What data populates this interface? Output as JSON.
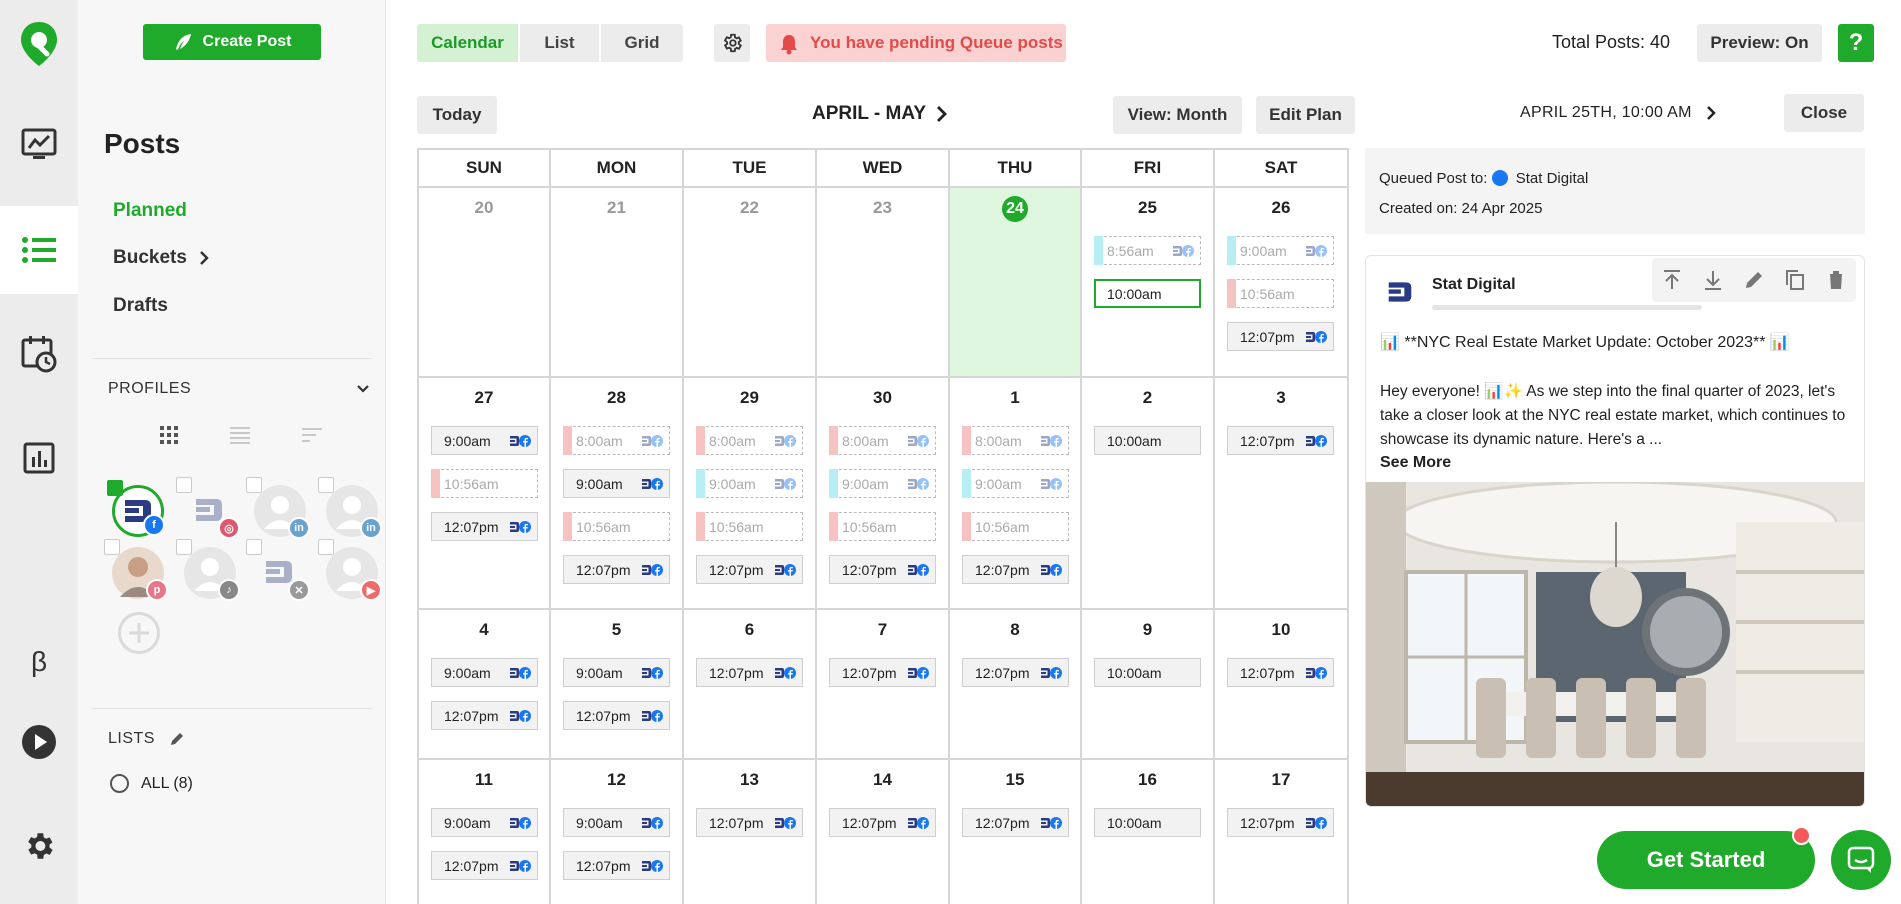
{
  "sidebar": {
    "create_post_label": "Create Post",
    "title": "Posts",
    "nav": [
      "Planned",
      "Buckets",
      "Drafts"
    ],
    "profiles_label": "PROFILES",
    "lists_label": "LISTS",
    "all_label": "ALL (8)",
    "rail_icons": [
      "logo-pin-icon",
      "analytics-icon",
      "posts-list-icon",
      "schedule-icon",
      "reports-icon",
      "beta-icon",
      "play-icon",
      "settings-icon"
    ],
    "beta_glyph": "β"
  },
  "toolbar": {
    "views": [
      "Calendar",
      "List",
      "Grid"
    ],
    "alert_text": "You have pending Queue posts",
    "total_posts": "Total Posts: 40",
    "preview_label": "Preview: On",
    "help_label": "?"
  },
  "calendar": {
    "today_label": "Today",
    "range_label": "APRIL - MAY",
    "view_label": "View: Month",
    "edit_plan_label": "Edit Plan",
    "days_of_week": [
      "SUN",
      "MON",
      "TUE",
      "WED",
      "THU",
      "FRI",
      "SAT"
    ],
    "weeks": [
      [
        {
          "day": "20",
          "state": "past",
          "posts": []
        },
        {
          "day": "21",
          "state": "past",
          "posts": []
        },
        {
          "day": "22",
          "state": "past",
          "posts": []
        },
        {
          "day": "23",
          "state": "past",
          "posts": []
        },
        {
          "day": "24",
          "state": "today",
          "posts": []
        },
        {
          "day": "25",
          "state": "",
          "posts": [
            {
              "time": "8:56am",
              "style": "dashed",
              "bar": "cyan",
              "icon": true
            },
            {
              "time": "10:00am",
              "style": "selected",
              "bar": "",
              "icon": false
            }
          ]
        },
        {
          "day": "26",
          "state": "",
          "posts": [
            {
              "time": "9:00am",
              "style": "dashed",
              "bar": "cyan",
              "icon": true
            },
            {
              "time": "10:56am",
              "style": "dashed",
              "bar": "pink",
              "icon": false
            },
            {
              "time": "12:07pm",
              "style": "solid",
              "bar": "",
              "icon": true
            }
          ]
        }
      ],
      [
        {
          "day": "27",
          "state": "",
          "posts": [
            {
              "time": "9:00am",
              "style": "solid",
              "bar": "",
              "icon": true
            },
            {
              "time": "10:56am",
              "style": "dashed",
              "bar": "pink",
              "icon": false
            },
            {
              "time": "12:07pm",
              "style": "solid",
              "bar": "",
              "icon": true
            }
          ]
        },
        {
          "day": "28",
          "state": "",
          "posts": [
            {
              "time": "8:00am",
              "style": "dashed",
              "bar": "pink",
              "icon": true
            },
            {
              "time": "9:00am",
              "style": "solid",
              "bar": "",
              "icon": true
            },
            {
              "time": "10:56am",
              "style": "dashed",
              "bar": "pink",
              "icon": false
            },
            {
              "time": "12:07pm",
              "style": "solid",
              "bar": "",
              "icon": true
            }
          ]
        },
        {
          "day": "29",
          "state": "",
          "posts": [
            {
              "time": "8:00am",
              "style": "dashed",
              "bar": "pink",
              "icon": true
            },
            {
              "time": "9:00am",
              "style": "dashed",
              "bar": "cyan",
              "icon": true
            },
            {
              "time": "10:56am",
              "style": "dashed",
              "bar": "pink",
              "icon": false
            },
            {
              "time": "12:07pm",
              "style": "solid",
              "bar": "",
              "icon": true
            }
          ]
        },
        {
          "day": "30",
          "state": "",
          "posts": [
            {
              "time": "8:00am",
              "style": "dashed",
              "bar": "pink",
              "icon": true
            },
            {
              "time": "9:00am",
              "style": "dashed",
              "bar": "cyan",
              "icon": true
            },
            {
              "time": "10:56am",
              "style": "dashed",
              "bar": "pink",
              "icon": false
            },
            {
              "time": "12:07pm",
              "style": "solid",
              "bar": "",
              "icon": true
            }
          ]
        },
        {
          "day": "1",
          "state": "",
          "posts": [
            {
              "time": "8:00am",
              "style": "dashed",
              "bar": "pink",
              "icon": true
            },
            {
              "time": "9:00am",
              "style": "dashed",
              "bar": "cyan",
              "icon": true
            },
            {
              "time": "10:56am",
              "style": "dashed",
              "bar": "pink",
              "icon": false
            },
            {
              "time": "12:07pm",
              "style": "solid",
              "bar": "",
              "icon": true
            }
          ]
        },
        {
          "day": "2",
          "state": "",
          "posts": [
            {
              "time": "10:00am",
              "style": "solid",
              "bar": "",
              "icon": false
            }
          ]
        },
        {
          "day": "3",
          "state": "",
          "posts": [
            {
              "time": "12:07pm",
              "style": "solid",
              "bar": "",
              "icon": true
            }
          ]
        }
      ],
      [
        {
          "day": "4",
          "state": "",
          "posts": [
            {
              "time": "9:00am",
              "style": "solid",
              "bar": "",
              "icon": true
            },
            {
              "time": "12:07pm",
              "style": "solid",
              "bar": "",
              "icon": true
            }
          ]
        },
        {
          "day": "5",
          "state": "",
          "posts": [
            {
              "time": "9:00am",
              "style": "solid",
              "bar": "",
              "icon": true
            },
            {
              "time": "12:07pm",
              "style": "solid",
              "bar": "",
              "icon": true
            }
          ]
        },
        {
          "day": "6",
          "state": "",
          "posts": [
            {
              "time": "12:07pm",
              "style": "solid",
              "bar": "",
              "icon": true
            }
          ]
        },
        {
          "day": "7",
          "state": "",
          "posts": [
            {
              "time": "12:07pm",
              "style": "solid",
              "bar": "",
              "icon": true
            }
          ]
        },
        {
          "day": "8",
          "state": "",
          "posts": [
            {
              "time": "12:07pm",
              "style": "solid",
              "bar": "",
              "icon": true
            }
          ]
        },
        {
          "day": "9",
          "state": "",
          "posts": [
            {
              "time": "10:00am",
              "style": "solid",
              "bar": "",
              "icon": false
            }
          ]
        },
        {
          "day": "10",
          "state": "",
          "posts": [
            {
              "time": "12:07pm",
              "style": "solid",
              "bar": "",
              "icon": true
            }
          ]
        }
      ],
      [
        {
          "day": "11",
          "state": "",
          "posts": [
            {
              "time": "9:00am",
              "style": "solid",
              "bar": "",
              "icon": true
            },
            {
              "time": "12:07pm",
              "style": "solid",
              "bar": "",
              "icon": true
            }
          ]
        },
        {
          "day": "12",
          "state": "",
          "posts": [
            {
              "time": "9:00am",
              "style": "solid",
              "bar": "",
              "icon": true
            },
            {
              "time": "12:07pm",
              "style": "solid",
              "bar": "",
              "icon": true
            }
          ]
        },
        {
          "day": "13",
          "state": "",
          "posts": [
            {
              "time": "12:07pm",
              "style": "solid",
              "bar": "",
              "icon": true
            }
          ]
        },
        {
          "day": "14",
          "state": "",
          "posts": [
            {
              "time": "12:07pm",
              "style": "solid",
              "bar": "",
              "icon": true
            }
          ]
        },
        {
          "day": "15",
          "state": "",
          "posts": [
            {
              "time": "12:07pm",
              "style": "solid",
              "bar": "",
              "icon": true
            }
          ]
        },
        {
          "day": "16",
          "state": "",
          "posts": [
            {
              "time": "10:00am",
              "style": "solid",
              "bar": "",
              "icon": false
            }
          ]
        },
        {
          "day": "17",
          "state": "",
          "posts": [
            {
              "time": "12:07pm",
              "style": "solid",
              "bar": "",
              "icon": true
            }
          ]
        }
      ]
    ]
  },
  "detail": {
    "when": "APRIL 25TH, 10:00 AM",
    "close_label": "Close",
    "queued_prefix": "Queued Post to:",
    "queued_profile": "Stat Digital",
    "created_on": "Created on: 24 Apr 2025",
    "author": "Stat Digital",
    "headline": "📊 **NYC Real Estate Market Update: October 2023** 📊",
    "body": "Hey everyone! 📊✨ As we step into the final quarter of 2023, let's take a closer look at the NYC real estate market, which continues to showcase its dynamic nature. Here's a ...",
    "see_more": "See More",
    "tool_icons": [
      "move-top-icon",
      "move-bottom-icon",
      "edit-icon",
      "duplicate-icon",
      "delete-icon"
    ]
  },
  "footer": {
    "get_started_label": "Get Started"
  },
  "colors": {
    "brand_green": "#1faa2b",
    "light_green": "#dff7df",
    "alert_bg": "#fbd2d2",
    "alert_text": "#e34b4b",
    "facebook_blue": "#1877f2"
  }
}
